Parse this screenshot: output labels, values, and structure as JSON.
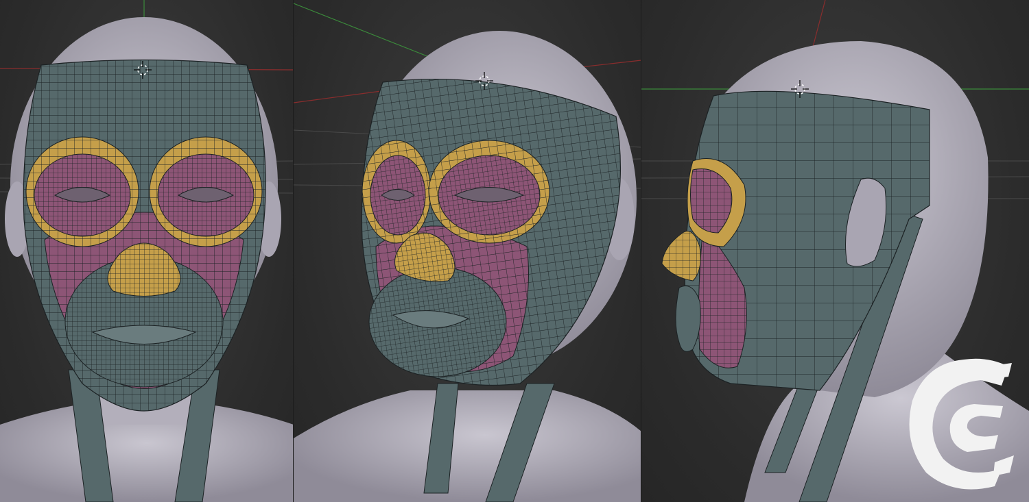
{
  "viewports": [
    {
      "id": "front",
      "view": "front"
    },
    {
      "id": "three-quarter",
      "view": "three-quarter"
    },
    {
      "id": "side",
      "view": "side"
    }
  ],
  "colors": {
    "background": "#2c2c2c",
    "head_base": "#b7b3bf",
    "mesh_teal": "#56696b",
    "eye_ring_yellow": "#c59f4a",
    "eye_socket_pink": "#8d5576",
    "cheek_pink": "#8d5576",
    "nose_yellow": "#c59f4a",
    "wireframe": "#1c2224",
    "axis_x": "#8a2d2d",
    "axis_y": "#3b8a3b",
    "watermark": "#f2f2f2"
  },
  "icons": {
    "cursor": "3d-cursor-icon",
    "watermark": "cg-cookie-logo-icon"
  }
}
